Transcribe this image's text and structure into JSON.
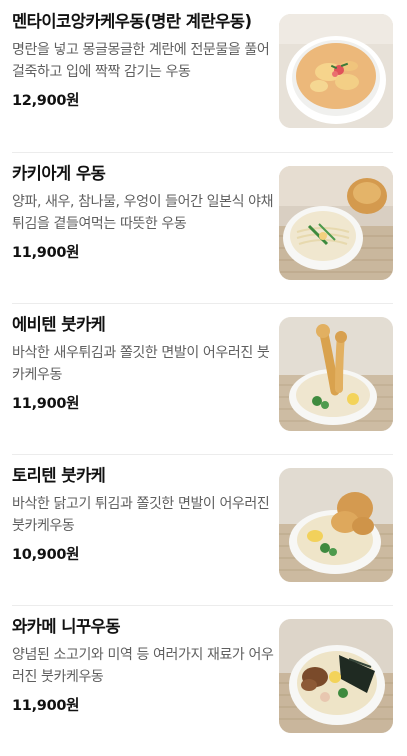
{
  "menu": {
    "items": [
      {
        "name": "멘타이코앙카케우동(명란 계란우동)",
        "description": "명란을 넣고 몽글몽글한 계란에 전문물을 풀어 걸죽하고 입에 짝짝 감기는 우동",
        "price": "12,900원",
        "image_icon": "egg-udon-photo-icon"
      },
      {
        "name": "카키아게 우동",
        "description": "양파, 새우, 참나물, 우엉이 들어간 일본식 야채튀김을 곁들여먹는 따뜻한 우동",
        "price": "11,900원",
        "image_icon": "kakiage-udon-photo-icon"
      },
      {
        "name": "에비텐 붓카케",
        "description": "바삭한 새우튀김과 쫄깃한 면발이 어우러진 붓카케우동",
        "price": "11,900원",
        "image_icon": "ebiten-bukkake-photo-icon"
      },
      {
        "name": "토리텐 붓카케",
        "description": "바삭한 닭고기 튀김과 쫄깃한 면발이 어우러진 붓카케우동",
        "price": "10,900원",
        "image_icon": "toriten-bukkake-photo-icon"
      },
      {
        "name": "와카메 니꾸우동",
        "description": "양념된 소고기와 미역 등 여러가지 재료가 어우러진 붓카케우동",
        "price": "11,900원",
        "image_icon": "wakame-niku-udon-photo-icon"
      }
    ]
  }
}
